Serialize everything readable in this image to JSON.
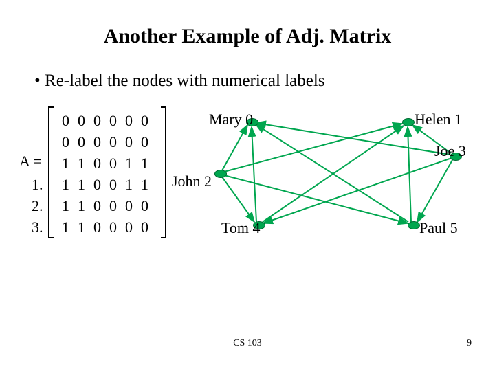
{
  "title": "Another Example of Adj. Matrix",
  "bullet": "Re-label the nodes with numerical labels",
  "matrix": {
    "label": "A =",
    "rows": [
      [
        "0",
        "0",
        "0",
        "0",
        "0",
        "0"
      ],
      [
        "0",
        "0",
        "0",
        "0",
        "0",
        "0"
      ],
      [
        "1",
        "1",
        "0",
        "0",
        "1",
        "1"
      ],
      [
        "1",
        "1",
        "0",
        "0",
        "1",
        "1"
      ],
      [
        "1",
        "1",
        "0",
        "0",
        "0",
        "0"
      ],
      [
        "1",
        "1",
        "0",
        "0",
        "0",
        "0"
      ]
    ],
    "row_numbers": [
      "1.",
      "2.",
      "3."
    ]
  },
  "graph": {
    "nodes": {
      "mary": {
        "label": "Mary 0"
      },
      "helen": {
        "label": "Helen 1"
      },
      "john": {
        "label": "John 2"
      },
      "joe": {
        "label": "Joe 3"
      },
      "tom": {
        "label": "Tom 4"
      },
      "paul": {
        "label": "Paul 5"
      }
    }
  },
  "footer": {
    "course": "CS 103",
    "page": "9"
  }
}
